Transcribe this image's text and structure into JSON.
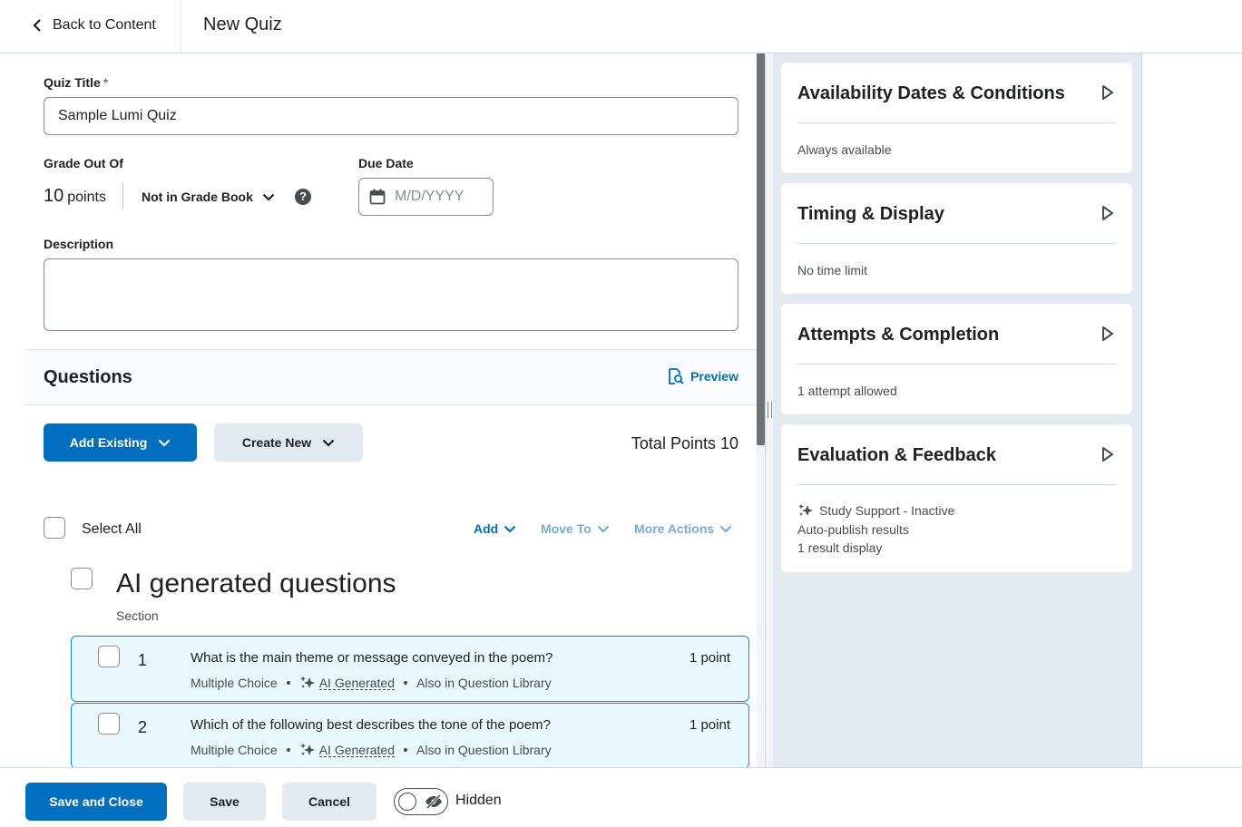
{
  "topbar": {
    "back_label": "Back to Content",
    "page_title": "New Quiz"
  },
  "form": {
    "quiz_title_label": "Quiz Title",
    "required_mark": "*",
    "quiz_title_value": "Sample Lumi Quiz",
    "grade_out_of_label": "Grade Out Of",
    "grade_value": "10",
    "grade_unit": "points",
    "gradebook_select": "Not in Grade Book",
    "help_glyph": "?",
    "due_date_label": "Due Date",
    "due_date_placeholder": "M/D/YYYY",
    "description_label": "Description",
    "description_value": ""
  },
  "questions": {
    "header": "Questions",
    "preview_label": "Preview",
    "add_existing_label": "Add Existing",
    "create_new_label": "Create New",
    "total_points": "Total Points 10",
    "select_all_label": "Select All",
    "actions": {
      "add": "Add",
      "move_to": "Move To",
      "more_actions": "More Actions"
    },
    "section": {
      "title": "AI generated questions",
      "subtitle": "Section"
    },
    "items": [
      {
        "number": "1",
        "text": "What is the main theme or message conveyed in the poem?",
        "points": "1 point",
        "type": "Multiple Choice",
        "ai_label": "AI Generated",
        "library": "Also in Question Library"
      },
      {
        "number": "2",
        "text": "Which of the following best describes the tone of the poem?",
        "points": "1 point",
        "type": "Multiple Choice",
        "ai_label": "AI Generated",
        "library": "Also in Question Library"
      }
    ]
  },
  "panel": {
    "cards": [
      {
        "title": "Availability Dates & Conditions",
        "lines": [
          "Always available"
        ]
      },
      {
        "title": "Timing & Display",
        "lines": [
          "No time limit"
        ]
      },
      {
        "title": "Attempts & Completion",
        "lines": [
          "1 attempt allowed"
        ]
      },
      {
        "title": "Evaluation & Feedback",
        "lines": [
          "Study Support - Inactive",
          "Auto-publish results",
          "1 result display"
        ]
      }
    ]
  },
  "footer": {
    "save_close_label": "Save and Close",
    "save_label": "Save",
    "cancel_label": "Cancel",
    "visibility_label": "Hidden"
  },
  "colors": {
    "primary": "#006fbf",
    "secondary_button": "#e3e9f1",
    "question_card_bg": "#e8f8fc",
    "question_card_border": "#0e8fcf",
    "panel_bg": "#e3e9f1"
  },
  "icons": {
    "back": "chevron-left-icon",
    "dropdown": "chevron-down-icon",
    "help": "help-icon",
    "calendar": "calendar-icon",
    "preview": "preview-icon",
    "ai": "sparkle-icon",
    "expand": "triangle-right-icon",
    "visibility": "eye-off-icon"
  }
}
